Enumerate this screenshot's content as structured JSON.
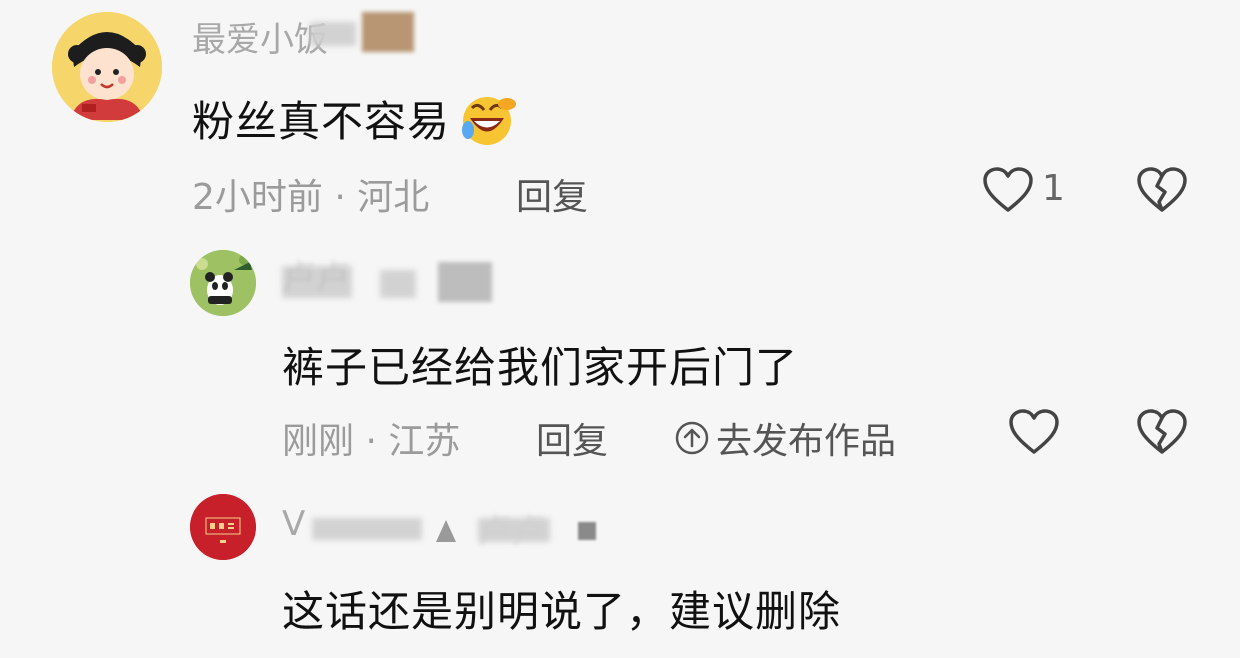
{
  "comments": [
    {
      "username": "最爱小饭",
      "text": "粉丝真不容易",
      "emoji": "🤣",
      "meta": "2小时前 · 河北",
      "reply_label": "回复",
      "like_count": "1",
      "icons": [
        "heart-icon",
        "broken-heart-icon"
      ]
    },
    {
      "username": "卢卢",
      "text": "裤子已经给我们家开后门了",
      "meta": "刚刚 · 江苏",
      "reply_label": "回复",
      "publish_label": "去发布作品",
      "icons": [
        "arrow-up-circle-icon",
        "heart-icon",
        "broken-heart-icon"
      ]
    },
    {
      "username": "V",
      "reply_to": "卢卢",
      "text": "这话还是别明说了，建议删除"
    }
  ],
  "colors": {
    "background": "#f6f6f6",
    "meta_text": "#9b9b9b",
    "content_text": "#111111",
    "avatar3_red": "#c8202a"
  }
}
